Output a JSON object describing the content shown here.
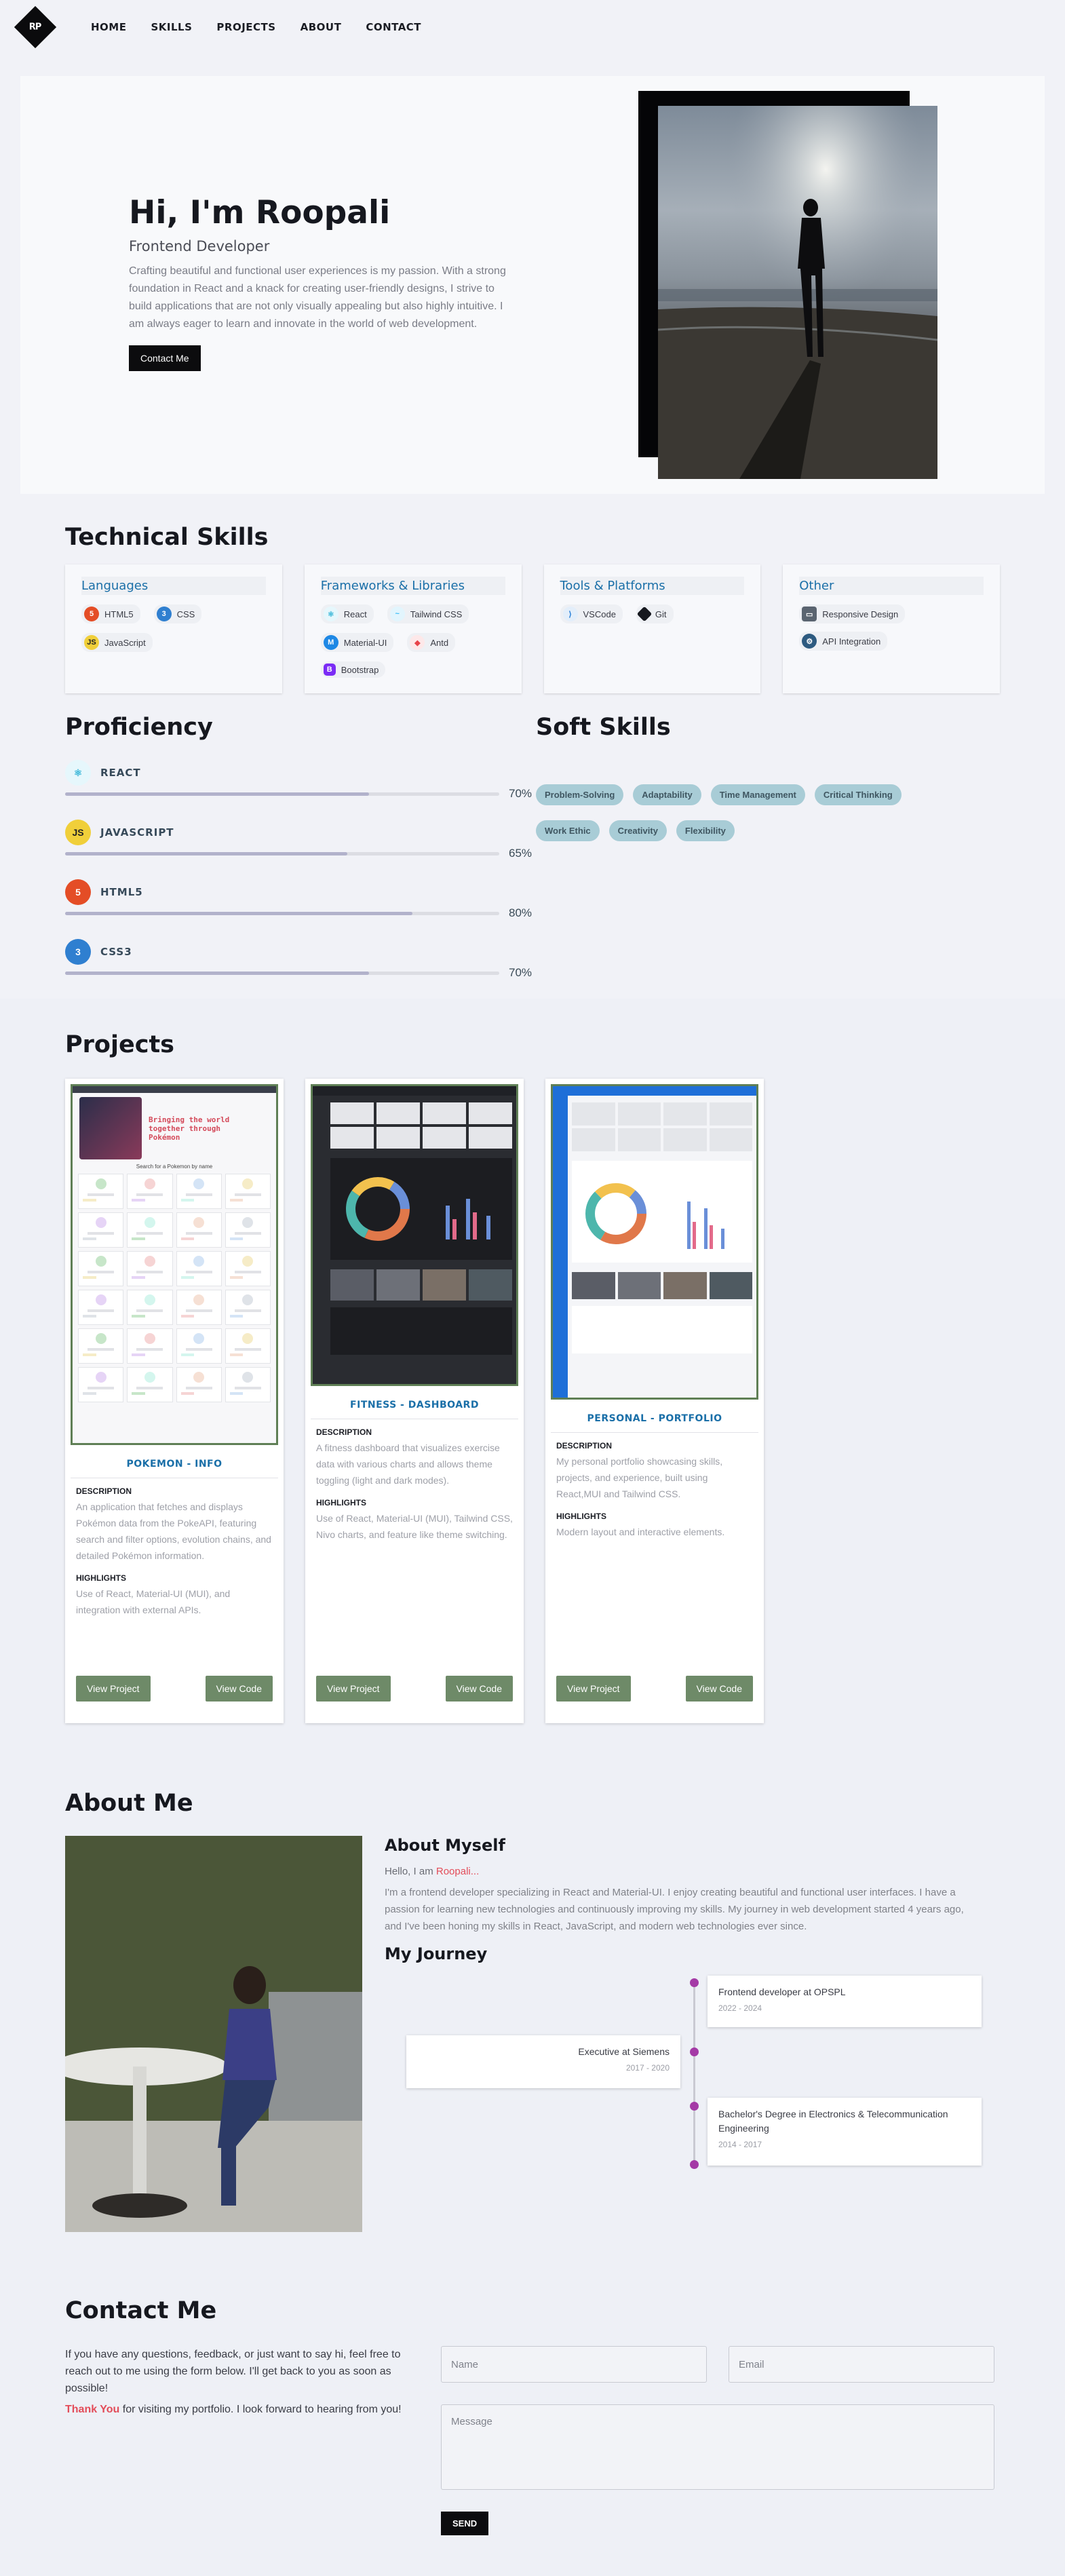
{
  "nav": {
    "logo_text": "RP",
    "links": [
      "HOME",
      "SKILLS",
      "PROJECTS",
      "ABOUT",
      "CONTACT"
    ]
  },
  "hero": {
    "title": "Hi, I'm Roopali",
    "subtitle": "Frontend Developer",
    "description": "Crafting beautiful and functional user experiences is my passion. With a strong foundation in React and a knack for creating user-friendly designs, I strive to build applications that are not only visually appealing but also highly intuitive. I am always eager to learn and innovate in the world of web development.",
    "cta": "Contact Me"
  },
  "technical_skills": {
    "title": "Technical Skills",
    "groups": [
      {
        "title": "Languages",
        "items": [
          {
            "name": "HTML5",
            "icon": "html5-icon",
            "color": "#e44d26"
          },
          {
            "name": "CSS",
            "icon": "css3-icon",
            "color": "#2f7fd0"
          },
          {
            "name": "JavaScript",
            "icon": "javascript-icon",
            "color": "#f0cf3a"
          }
        ]
      },
      {
        "title": "Frameworks & Libraries",
        "items": [
          {
            "name": "React",
            "icon": "react-icon",
            "color": "#61dafb"
          },
          {
            "name": "Tailwind CSS",
            "icon": "tailwind-icon",
            "color": "#38bdf8"
          },
          {
            "name": "Material-UI",
            "icon": "material-ui-icon",
            "color": "#1e88e5"
          },
          {
            "name": "Antd",
            "icon": "antd-icon",
            "color": "#e8444a"
          },
          {
            "name": "Bootstrap",
            "icon": "bootstrap-icon",
            "color": "#7b2cf5"
          }
        ]
      },
      {
        "title": "Tools & Platforms",
        "items": [
          {
            "name": "VSCode",
            "icon": "vscode-icon",
            "color": "#1e7ad6"
          },
          {
            "name": "Git",
            "icon": "git-icon",
            "color": "#16181f"
          }
        ]
      },
      {
        "title": "Other",
        "items": [
          {
            "name": "Responsive Design",
            "icon": "responsive-design-icon",
            "color": "#5a6470"
          },
          {
            "name": "API Integration",
            "icon": "api-integration-icon",
            "color": "#2d5a80"
          }
        ]
      }
    ]
  },
  "proficiency": {
    "title": "Proficiency",
    "items": [
      {
        "name": "REACT",
        "percent": 70,
        "pct_label": "70%",
        "icon": "react-icon",
        "color": "#61dafb"
      },
      {
        "name": "JAVASCRIPT",
        "percent": 65,
        "pct_label": "65%",
        "icon": "javascript-icon",
        "color": "#f0cf3a"
      },
      {
        "name": "HTML5",
        "percent": 80,
        "pct_label": "80%",
        "icon": "html5-icon",
        "color": "#e44d26"
      },
      {
        "name": "CSS3",
        "percent": 70,
        "pct_label": "70%",
        "icon": "css3-icon",
        "color": "#2f7fd0"
      }
    ]
  },
  "soft_skills": {
    "title": "Soft Skills",
    "items": [
      "Problem-Solving",
      "Adaptability",
      "Time Management",
      "Critical Thinking",
      "Work Ethic",
      "Creativity",
      "Flexibility"
    ]
  },
  "projects": {
    "title": "Projects",
    "description_label": "DESCRIPTION",
    "highlights_label": "HIGHLIGHTS",
    "view_project_label": "View Project",
    "view_code_label": "View Code",
    "items": [
      {
        "title": "POKEMON - INFO",
        "description": "An application that fetches and displays Pokémon data from the PokeAPI, featuring search and filter options, evolution chains, and detailed Pokémon information.",
        "highlights": "Use of React, Material-UI (MUI), and integration with external APIs.",
        "shot_banner": "Bringing the world together through Pokémon",
        "shot_search": "Search for a Pokemon by name"
      },
      {
        "title": "FITNESS - DASHBOARD",
        "description": "A fitness dashboard that visualizes exercise data with various charts and allows theme toggling (light and dark modes).",
        "highlights": "Use of React, Material-UI (MUI), Tailwind CSS, Nivo charts, and feature like theme switching."
      },
      {
        "title": "PERSONAL - PORTFOLIO",
        "description": "My personal portfolio showcasing skills, projects, and experience, built using React,MUI and Tailwind CSS.",
        "highlights": "Modern layout and interactive elements."
      }
    ]
  },
  "about": {
    "title": "About Me",
    "subtitle": "About Myself",
    "hello_prefix": "Hello, I am",
    "hello_name": "Roopali...",
    "bio": "I'm a frontend developer specializing in React and Material-UI. I enjoy creating beautiful and functional user interfaces. I have a passion for learning new technologies and continuously improving my skills. My journey in web development started 4 years ago, and I've been honing my skills in React, JavaScript, and modern web technologies ever since.",
    "journey_title": "My Journey",
    "journey": [
      {
        "title": "Frontend developer at OPSPL",
        "dates": "2022 - 2024",
        "side": "right"
      },
      {
        "title": "Executive at Siemens",
        "dates": "2017 - 2020",
        "side": "left"
      },
      {
        "title": "Bachelor's Degree in Electronics & Telecommunication Engineering",
        "dates": "2014 - 2017",
        "side": "right"
      }
    ]
  },
  "contact": {
    "title": "Contact Me",
    "intro": "If you have any questions, feedback, or just want to say hi, feel free to reach out to me using the form below. I'll get back to you as soon as possible!",
    "thanks_emph": "Thank You",
    "thanks_rest": " for visiting my portfolio. I look forward to hearing from you!",
    "name_placeholder": "Name",
    "email_placeholder": "Email",
    "message_placeholder": "Message",
    "send_label": "SEND"
  }
}
